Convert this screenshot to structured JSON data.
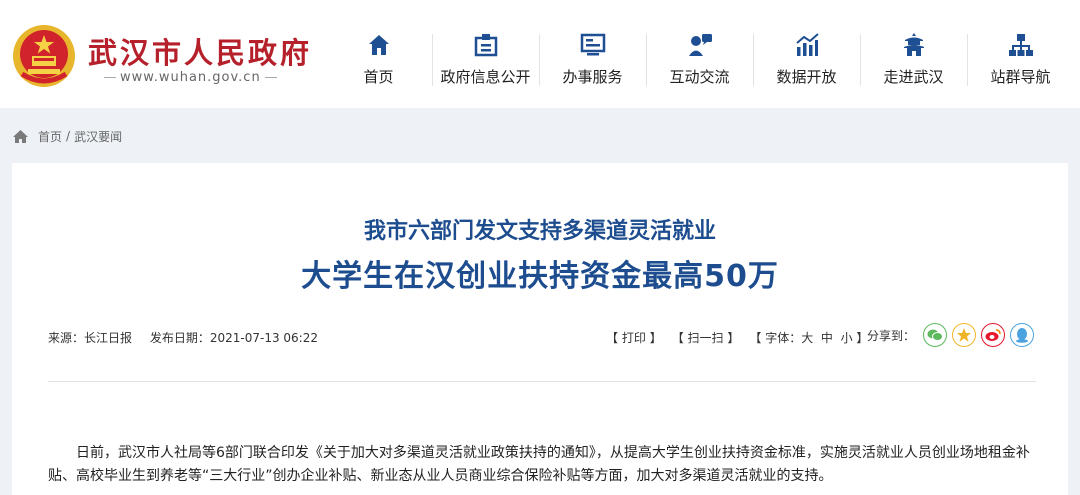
{
  "site": {
    "name": "武汉市人民政府",
    "url": "www.wuhan.gov.cn"
  },
  "nav": [
    {
      "label": "首页",
      "icon": "home-icon"
    },
    {
      "label": "政府信息公开",
      "icon": "info-board-icon"
    },
    {
      "label": "办事服务",
      "icon": "service-screen-icon"
    },
    {
      "label": "互动交流",
      "icon": "chat-person-icon"
    },
    {
      "label": "数据开放",
      "icon": "bar-chart-icon"
    },
    {
      "label": "走进武汉",
      "icon": "tower-icon"
    },
    {
      "label": "站群导航",
      "icon": "sitemap-icon"
    }
  ],
  "breadcrumb": {
    "home": "首页",
    "separator": "/",
    "current": "武汉要闻"
  },
  "article": {
    "title_line1": "我市六部门发文支持多渠道灵活就业",
    "title_line2": "大学生在汉创业扶持资金最高50万",
    "source": "来源：长江日报",
    "date": "发布日期：2021-07-13 06:22",
    "paragraph": "日前，武汉市人社局等6部门联合印发《关于加大对多渠道灵活就业政策扶持的通知》，从提高大学生创业扶持资金标准，实施灵活就业人员创业场地租金补贴、高校毕业生到养老等“三大行业”创办企业补贴、新业态从业人员商业综合保险补贴等方面，加大对多渠道灵活就业的支持。"
  },
  "tools": {
    "print": "打印",
    "scan": "扫一扫",
    "font_label": "字体：",
    "font_large": "大",
    "font_medium": "中",
    "font_small": "小",
    "bracket_open": "【",
    "bracket_close": "】",
    "share_label": "分享到："
  },
  "share_buttons": [
    "wechat-icon",
    "qzone-icon",
    "weibo-icon",
    "qq-icon"
  ],
  "colors": {
    "brand_red": "#b5202a",
    "title_blue": "#1d4d8f",
    "nav_icon_blue": "#1e4f93",
    "page_bg": "#eef2f7"
  }
}
